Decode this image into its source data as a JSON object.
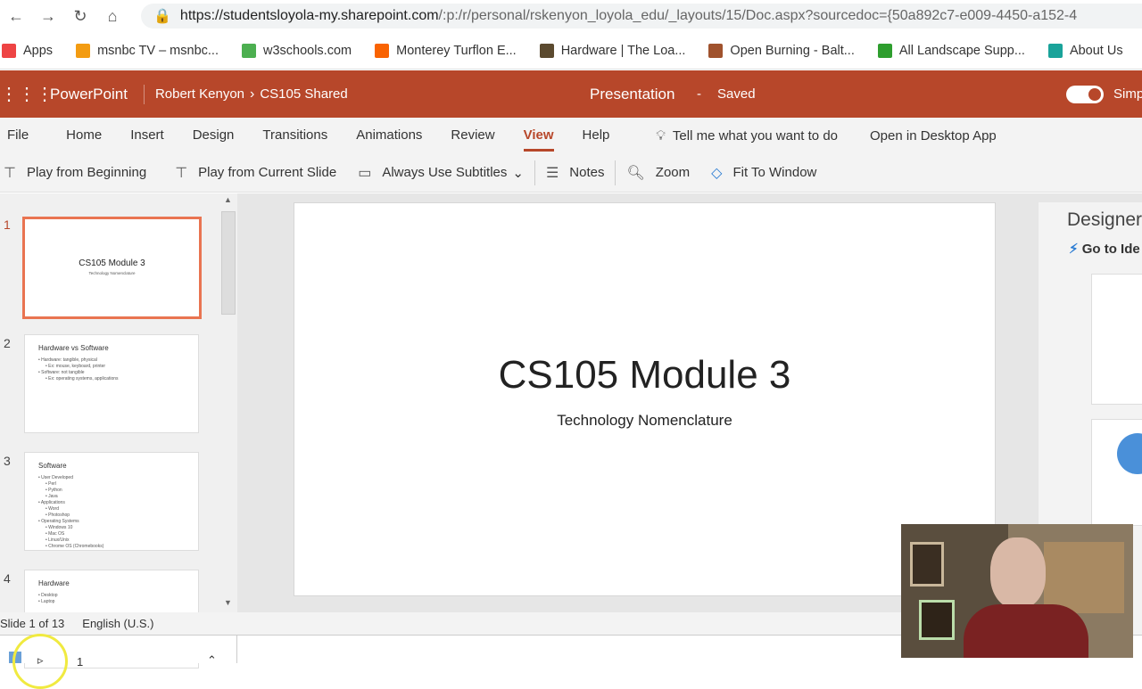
{
  "browser": {
    "url_main": "https://studentsloyola-my.sharepoint.com",
    "url_rest": "/:p:/r/personal/rskenyon_loyola_edu/_layouts/15/Doc.aspx?sourcedoc={50a892c7-e009-4450-a152-4"
  },
  "bookmarks": [
    {
      "label": "Apps",
      "color": "#e44"
    },
    {
      "label": "msnbc TV – msnbc...",
      "color": "#f39c12"
    },
    {
      "label": "w3schools.com",
      "color": "#4caf50"
    },
    {
      "label": "Monterey Turflon E...",
      "color": "#f96302"
    },
    {
      "label": "Hardware | The Loa...",
      "color": "#5b4a2f"
    },
    {
      "label": "Open Burning - Balt...",
      "color": "#a0522d"
    },
    {
      "label": "All Landscape Supp...",
      "color": "#2e9e2e"
    },
    {
      "label": "About Us",
      "color": "#1aa39a"
    }
  ],
  "app": {
    "name": "PowerPoint",
    "user": "Robert Kenyon",
    "folder": "CS105 Shared",
    "doc": "Presentation",
    "sep": "-",
    "status": "Saved",
    "toggle_label": "Simp"
  },
  "ribbon_tabs": [
    "File",
    "Home",
    "Insert",
    "Design",
    "Transitions",
    "Animations",
    "Review",
    "View",
    "Help"
  ],
  "active_tab": "View",
  "tell_me": "Tell me what you want to do",
  "open_desktop": "Open in Desktop App",
  "commands": {
    "play_beginning": "Play from Beginning",
    "play_current": "Play from Current Slide",
    "subtitles": "Always Use Subtitles",
    "notes": "Notes",
    "zoom": "Zoom",
    "fit": "Fit To Window"
  },
  "thumbnails": [
    {
      "num": "1",
      "title": "CS105 Module 3",
      "subtitle": "Technology Nomenclature"
    },
    {
      "num": "2",
      "title": "Hardware vs Software",
      "bullets": [
        [
          "Hardware: tangible, physical",
          1
        ],
        [
          "Ex: mouse, keyboard, printer",
          2
        ],
        [
          "Software: not tangible",
          1
        ],
        [
          "Ex: operating systems, applications",
          2
        ]
      ]
    },
    {
      "num": "3",
      "title": "Software",
      "bullets": [
        [
          "User Developed",
          1
        ],
        [
          "Perl",
          2
        ],
        [
          "Python",
          2
        ],
        [
          "Java",
          2
        ],
        [
          "Applications",
          1
        ],
        [
          "Word",
          2
        ],
        [
          "Photoshop",
          2
        ],
        [
          "Operating Systems",
          1
        ],
        [
          "Windows 10",
          2
        ],
        [
          "Mac OS",
          2
        ],
        [
          "Linux/Unix",
          2
        ],
        [
          "Chrome OS (Chromebooks)",
          2
        ]
      ]
    },
    {
      "num": "4",
      "title": "Hardware",
      "bullets": [
        [
          "Desktop",
          1
        ],
        [
          "Laptop",
          1
        ]
      ]
    }
  ],
  "slide": {
    "title": "CS105 Module 3",
    "subtitle": "Technology Nomenclature"
  },
  "designer": {
    "title": "Designer",
    "link": "Go to Ide"
  },
  "status": {
    "slide": "Slide 1 of 13",
    "lang": "English (U.S.)"
  },
  "bottom": {
    "page": "1"
  }
}
